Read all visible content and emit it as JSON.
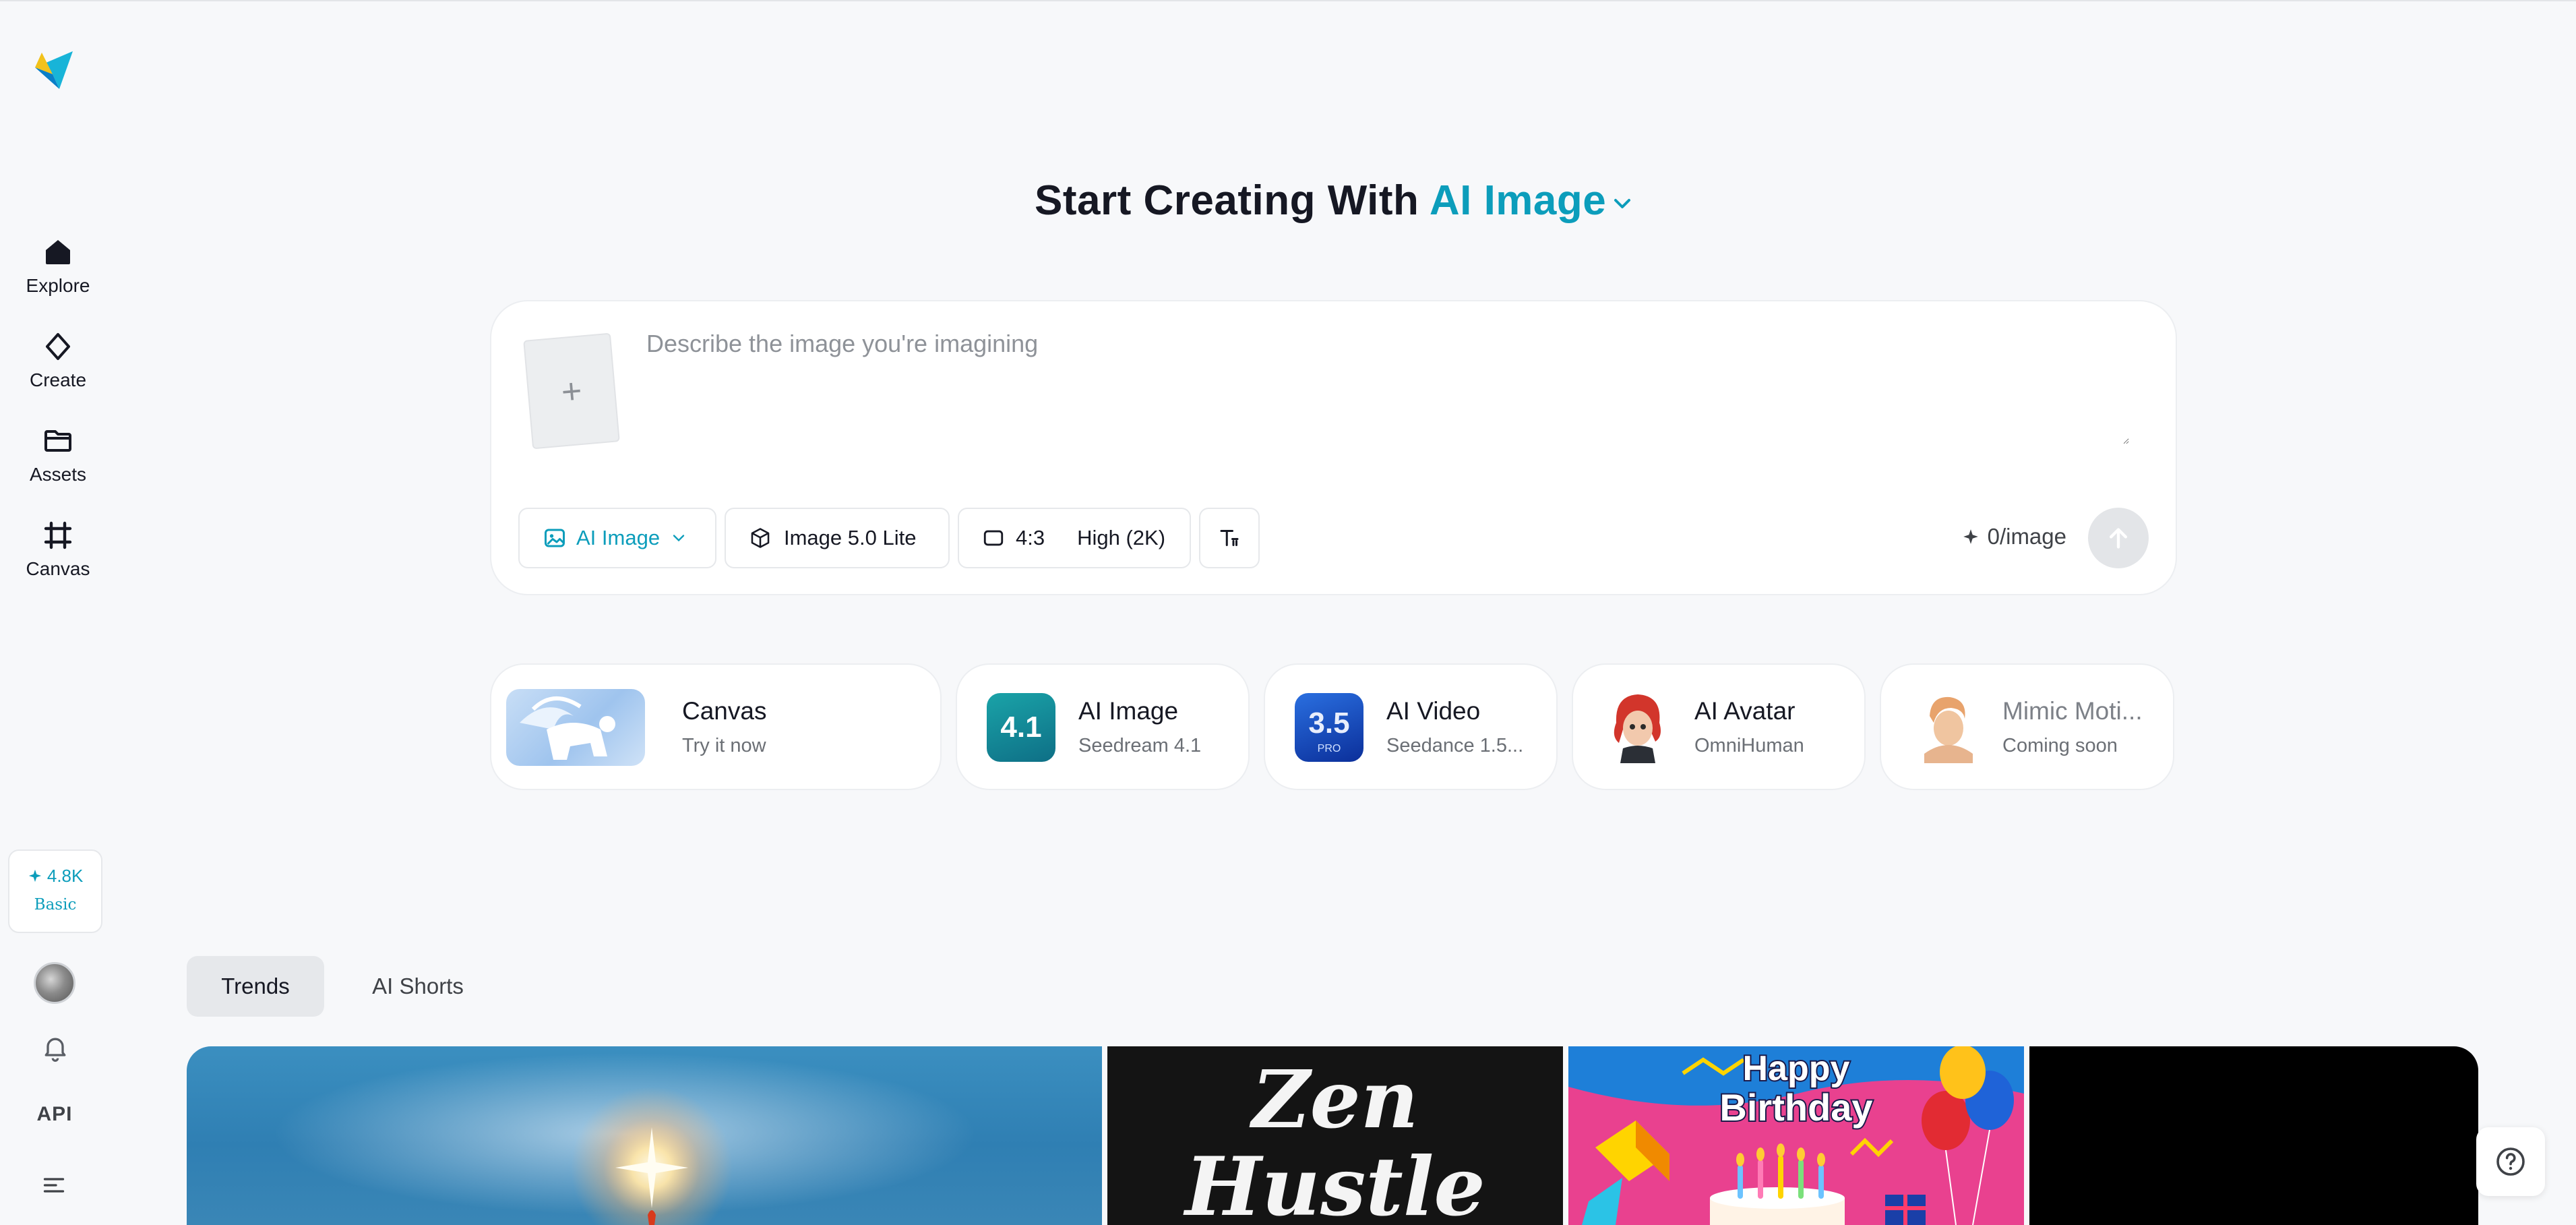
{
  "sidebar": {
    "nav": [
      {
        "label": "Explore",
        "icon": "home-icon"
      },
      {
        "label": "Create",
        "icon": "sparkle-diamond-icon"
      },
      {
        "label": "Assets",
        "icon": "folder-icon"
      },
      {
        "label": "Canvas",
        "icon": "crop-frame-icon"
      }
    ],
    "credits": {
      "amount": "4.8K",
      "plan": "Basic"
    },
    "api_label": "API"
  },
  "headline": {
    "prefix": "Start Creating With",
    "mode": "AI Image"
  },
  "prompt": {
    "placeholder": "Describe the image you're imagining",
    "value": "",
    "upload_symbol": "+",
    "toolbar": {
      "mode": "AI Image",
      "model": "Image 5.0 Lite",
      "ratio": "4:3",
      "quality": "High (2K)"
    },
    "cost": "0/image"
  },
  "tools": [
    {
      "title": "Canvas",
      "subtitle": "Try it now"
    },
    {
      "title": "AI Image",
      "subtitle": "Seedream 4.1",
      "badge": "4.1"
    },
    {
      "title": "AI Video",
      "subtitle": "Seedance 1.5...",
      "badge": "3.5",
      "badge_sub": "PRO"
    },
    {
      "title": "AI Avatar",
      "subtitle": "OmniHuman"
    },
    {
      "title": "Mimic Moti...",
      "subtitle": "Coming soon"
    }
  ],
  "tabs": [
    {
      "label": "Trends",
      "active": true
    },
    {
      "label": "AI Shorts",
      "active": false
    }
  ],
  "gallery": [
    {
      "name": "gallery-item-sky-glow"
    },
    {
      "name": "gallery-item-zen-hustle",
      "text": [
        "Zen",
        "Hustle"
      ]
    },
    {
      "name": "gallery-item-happy-birthday",
      "text": [
        "Happy",
        "Birthday"
      ]
    },
    {
      "name": "gallery-item-black"
    }
  ],
  "colors": {
    "accent": "#0c9dbb",
    "background": "#f7f8fa",
    "text": "#161823"
  }
}
